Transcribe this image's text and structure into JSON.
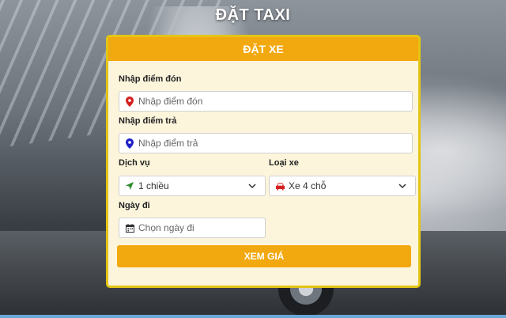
{
  "page": {
    "title": "ĐẶT TAXI"
  },
  "form": {
    "header": "ĐẶT XE",
    "pickup": {
      "label": "Nhập điểm đón",
      "placeholder": "Nhập điểm đón"
    },
    "dropoff": {
      "label": "Nhập điểm trả",
      "placeholder": "Nhập điểm trả"
    },
    "service": {
      "label": "Dịch vụ",
      "value": "1 chiều"
    },
    "vehicle": {
      "label": "Loại xe",
      "value": "Xe 4 chỗ"
    },
    "date": {
      "label": "Ngày đi",
      "placeholder": "Chọn ngày đi"
    },
    "submit_label": "XEM GIÁ"
  },
  "colors": {
    "header": "#f2a80f",
    "card_border": "#e3c513",
    "card_bg": "#fcf5dc",
    "pin_red": "#d62020",
    "pin_blue": "#2020c8",
    "arrow_green": "#2e8b2e",
    "car_red": "#d62020"
  },
  "icons": {
    "pickup": "map-pin-red-icon",
    "dropoff": "map-pin-blue-icon",
    "service": "navigation-arrow-icon",
    "vehicle": "car-icon",
    "date": "calendar-icon",
    "dropdown": "chevron-down-icon"
  }
}
